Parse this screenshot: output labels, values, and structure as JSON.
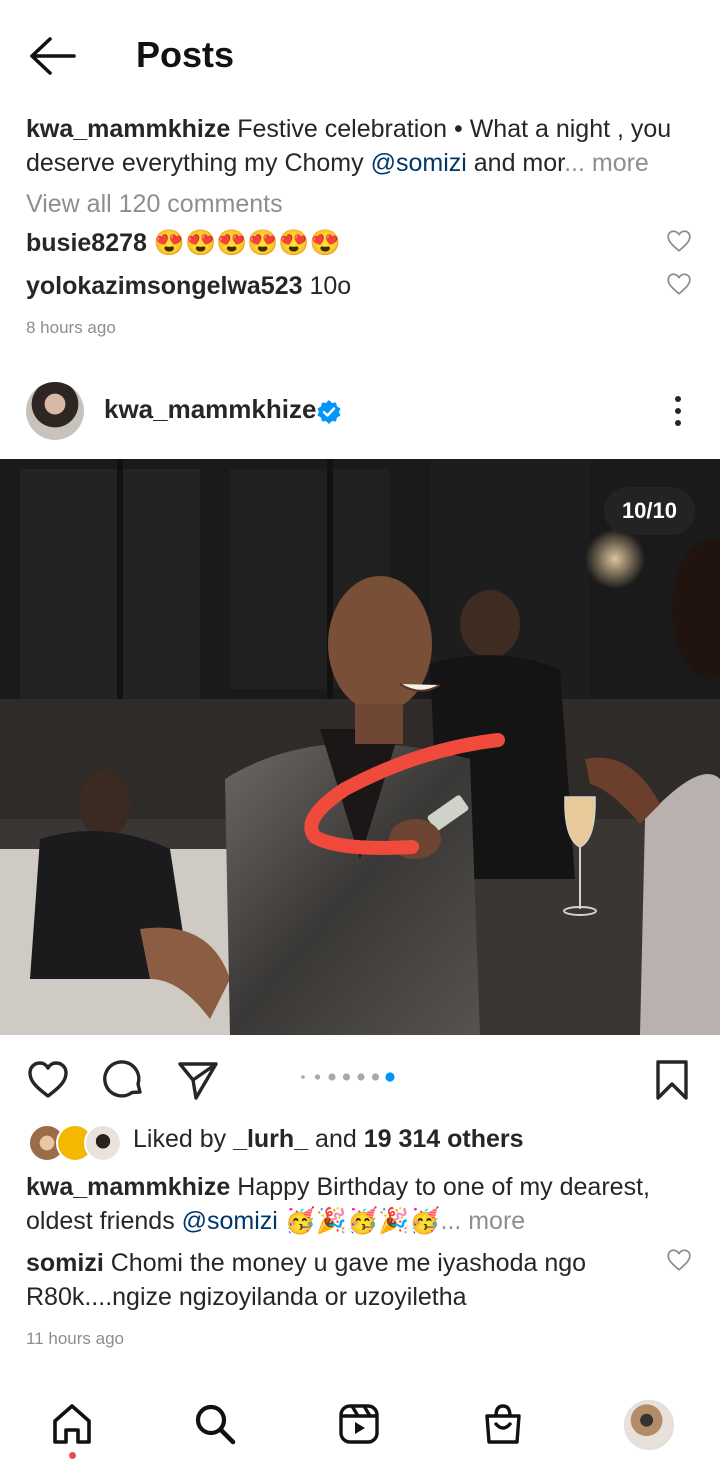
{
  "header": {
    "title": "Posts"
  },
  "prev_post": {
    "caption_user": "kwa_mammkhize",
    "caption_line1": "Festive celebration • What a night , you",
    "caption_line2_text": "deserve everything  my Chomy ",
    "caption_mention": "@somizi",
    "caption_line2_tail": " and mor",
    "more_label": "... more",
    "view_comments": "View all 120 comments",
    "comments": [
      {
        "user": "busie8278",
        "text": "😍😍😍😍😍😍"
      },
      {
        "user": "yolokazimsongelwa523",
        "text": "10o"
      }
    ],
    "time": "8 hours ago"
  },
  "post": {
    "username": "kwa_mammkhize",
    "counter": "10/10",
    "carousel": {
      "total": 7,
      "active_index": 6
    },
    "likes_prefix": "Liked by ",
    "liked_user": "_lurh_",
    "likes_mid": " and ",
    "likes_count": "19 314 others",
    "caption_user": "kwa_mammkhize",
    "caption_line1": "Happy Birthday to one of my dearest,",
    "caption_line2_text": "oldest friends ",
    "caption_mention": "@somizi",
    "caption_emoji": " 🥳🎉🥳🎉🥳",
    "more_label": "... more",
    "comment_user": "somizi",
    "comment_line1": "Chomi the money u gave me iyashoda ngo",
    "comment_line2": "R80k....ngize ngizoyilanda or uzoyiletha",
    "time": "11 hours ago"
  },
  "colors": {
    "accent": "#0095f6",
    "verified": "#0095f6",
    "mention": "#00376b",
    "muted": "#8e8e8e",
    "notification": "#ed4956"
  },
  "nav": {
    "items": [
      {
        "icon": "home-icon"
      },
      {
        "icon": "search-icon"
      },
      {
        "icon": "reels-icon"
      },
      {
        "icon": "shop-icon"
      },
      {
        "icon": "profile-avatar"
      }
    ]
  }
}
